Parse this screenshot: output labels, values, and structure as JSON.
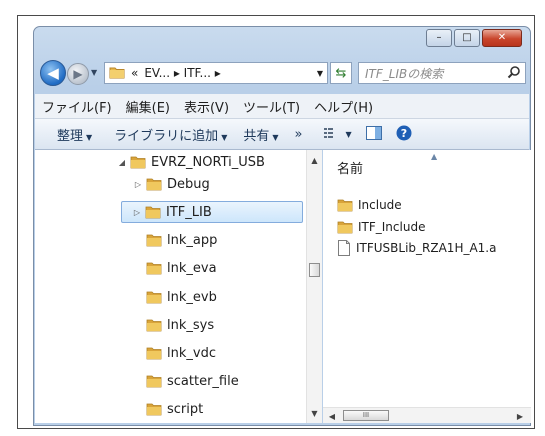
{
  "window": {
    "caption": {
      "minimize": "–",
      "maximize": "□",
      "close": "✕"
    }
  },
  "nav": {
    "address": {
      "prefix": "«",
      "path": "EV...  ▸ ITF...  ▸"
    },
    "search_placeholder": "ITF_LIBの検索"
  },
  "menu": [
    "ファイル(F)",
    "編集(E)",
    "表示(V)",
    "ツール(T)",
    "ヘルプ(H)"
  ],
  "toolbar": {
    "organize": "整理",
    "add_to_library": "ライブラリに追加",
    "share": "共有",
    "more": "»"
  },
  "tree": [
    {
      "label": "EVRZ_NORTi_USB",
      "twisty": "◢",
      "selected": false
    },
    {
      "label": "Debug",
      "twisty": "▷",
      "selected": false
    },
    {
      "label": "ITF_LIB",
      "twisty": "▷",
      "selected": true
    },
    {
      "label": "lnk_app",
      "twisty": "",
      "selected": false
    },
    {
      "label": "lnk_eva",
      "twisty": "",
      "selected": false
    },
    {
      "label": "lnk_evb",
      "twisty": "",
      "selected": false
    },
    {
      "label": "lnk_sys",
      "twisty": "",
      "selected": false
    },
    {
      "label": "lnk_vdc",
      "twisty": "",
      "selected": false
    },
    {
      "label": "scatter_file",
      "twisty": "",
      "selected": false
    },
    {
      "label": "script",
      "twisty": "",
      "selected": false
    }
  ],
  "content": {
    "column_name": "名前",
    "files": [
      {
        "name": "Include",
        "type": "folder"
      },
      {
        "name": "ITF_Include",
        "type": "folder"
      },
      {
        "name": "ITFUSBLib_RZA1H_A1.a",
        "type": "file"
      }
    ]
  },
  "colors": {
    "folder": "#e8b84a",
    "accent": "#1f6bc4",
    "selection": "#cde6fb"
  }
}
